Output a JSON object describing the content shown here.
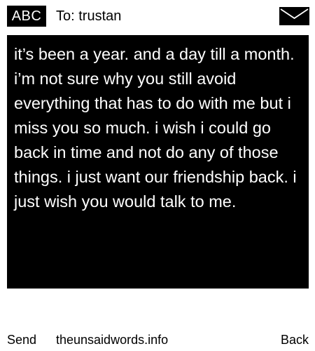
{
  "header": {
    "keyboard_mode_label": "ABC",
    "recipient_label": "To: trustan",
    "envelope_icon": "envelope-icon"
  },
  "message": {
    "text": "it’s been a year. and a day till a month. i’m not sure why you still avoid everything that has to do with me but i miss you so much. i wish i could go back in time and not do any of those things. i just want our friendship back. i just wish you would talk to me."
  },
  "footer": {
    "send_label": "Send",
    "site_label": "theunsaidwords.info",
    "back_label": "Back"
  },
  "colors": {
    "background": "#ffffff",
    "panel": "#000000",
    "panel_text": "#ffffff",
    "text": "#000000"
  }
}
